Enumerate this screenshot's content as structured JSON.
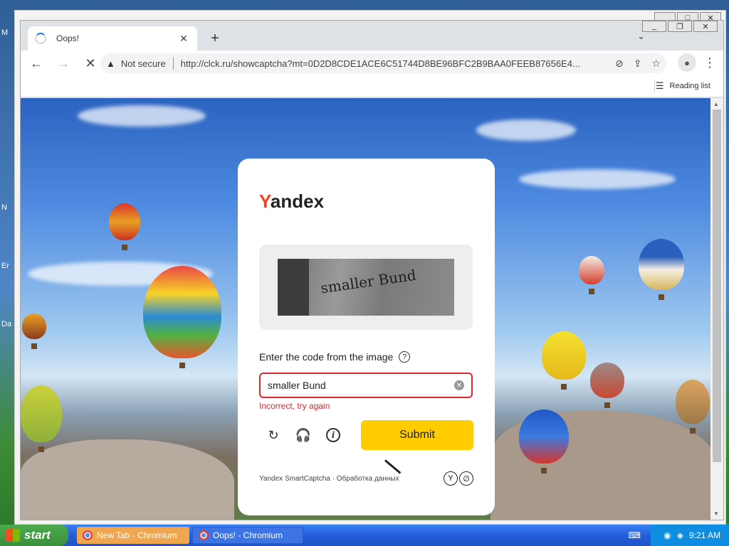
{
  "desktop": {
    "labels": [
      "M",
      "N",
      "Er",
      "Da"
    ]
  },
  "browser": {
    "tab": {
      "title": "Oops!"
    },
    "toolbar": {
      "back": "←",
      "forward": "→",
      "stop": "✕",
      "not_secure": "Not secure",
      "url": "http://clck.ru/showcaptcha?mt=0D2D8CDE1ACE6C51744D8BE96BFC2B9BAA0FEEB87656E4..."
    },
    "bookmarks": {
      "reading_list": "Reading list"
    }
  },
  "captcha_page": {
    "logo_first": "Y",
    "logo_rest": "andex",
    "captcha_text": "smaller Bund",
    "prompt": "Enter the code from the image",
    "input_value": "smaller Bund",
    "error": "Incorrect, try again",
    "submit": "Submit",
    "footer": "Yandex SmartCaptcha · Обработка данных"
  },
  "taskbar": {
    "start": "start",
    "tasks": [
      {
        "label": "New Tab - Chromium"
      },
      {
        "label": "Oops! - Chromium"
      }
    ],
    "clock": "9:21 AM"
  },
  "colors": {
    "brand_red": "#fc3f1d",
    "submit_yellow": "#ffcc00",
    "error_red": "#d9262b"
  }
}
